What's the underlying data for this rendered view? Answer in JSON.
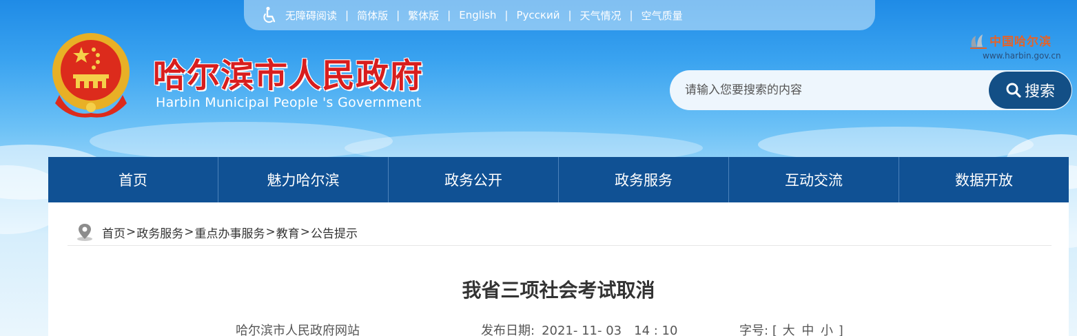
{
  "topbar": {
    "items": [
      "无障碍阅读",
      "简体版",
      "繁体版",
      "English",
      "Русский",
      "天气情况",
      "空气质量"
    ],
    "separator": "|"
  },
  "header": {
    "title": "哈尔滨市人民政府",
    "subtitle": "Harbin Municipal People 's Government",
    "logo_text": "中国哈尔滨",
    "logo_url": "www.harbin.gov.cn"
  },
  "search": {
    "placeholder": "请输入您要搜索的内容",
    "button_label": "搜索"
  },
  "nav": {
    "items": [
      "首页",
      "魅力哈尔滨",
      "政务公开",
      "政务服务",
      "互动交流",
      "数据开放"
    ]
  },
  "breadcrumb": {
    "items": [
      "首页",
      "政务服务",
      "重点办事服务",
      "教育",
      "公告提示"
    ],
    "separator": ">"
  },
  "article": {
    "title": "我省三项社会考试取消",
    "source": "哈尔滨市人民政府网站",
    "date_label": "发布日期:",
    "date_value": "2021- 11- 03　14 : 10",
    "font_size_label": "字号:",
    "font_size_open": "[",
    "font_size_large": "大",
    "font_size_medium": "中",
    "font_size_small": "小",
    "font_size_close": "]"
  },
  "colors": {
    "nav_bg": "#105194",
    "title_red": "#d81e1e",
    "search_button": "#134f86"
  }
}
